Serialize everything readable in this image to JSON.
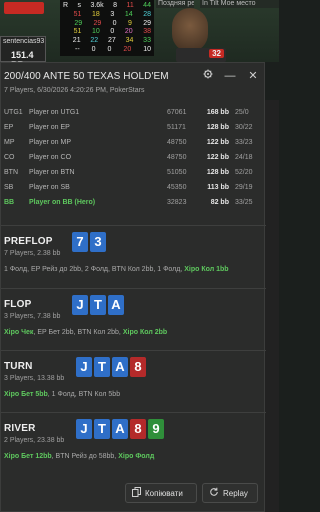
{
  "background": {
    "player_name": "sentencias93",
    "player_stack": "151.4 BB",
    "hud_rows": [
      [
        "R",
        "s",
        "3.6k",
        "8",
        "11",
        "44"
      ],
      [
        "",
        "51",
        "18",
        "3",
        "14",
        "28"
      ],
      [
        "",
        "29",
        "29",
        "0",
        "9",
        "29"
      ],
      [
        "",
        "51",
        "10",
        "0",
        "20",
        "38"
      ],
      [
        "",
        "21",
        "22",
        "27",
        "34",
        "33"
      ],
      [
        "",
        "--",
        "0",
        "0",
        "20",
        "10"
      ]
    ],
    "tab1": "Поздняя рег",
    "tab2": "In Tilt   Мое место",
    "badge_num": "32"
  },
  "dialog": {
    "title": "200/400 ANTE 50 TEXAS HOLD'EM",
    "subtitle": "7 Players, 6/30/2026 4:20:26 PM, PokerStars",
    "settings_icon": "gear-icon",
    "minimize_label": "—",
    "close_label": "✕"
  },
  "players": [
    {
      "pos": "UTG1",
      "name": "Player on UTG1",
      "chips": "67061",
      "bb": "168 bb",
      "vpip": "25/0"
    },
    {
      "pos": "EP",
      "name": "Player on EP",
      "chips": "51171",
      "bb": "128 bb",
      "vpip": "30/22"
    },
    {
      "pos": "MP",
      "name": "Player on MP",
      "chips": "48750",
      "bb": "122 bb",
      "vpip": "33/23"
    },
    {
      "pos": "CO",
      "name": "Player on CO",
      "chips": "48750",
      "bb": "122 bb",
      "vpip": "24/18"
    },
    {
      "pos": "BTN",
      "name": "Player on BTN",
      "chips": "51050",
      "bb": "128 bb",
      "vpip": "52/20"
    },
    {
      "pos": "SB",
      "name": "Player on SB",
      "chips": "45350",
      "bb": "113 bb",
      "vpip": "29/19"
    },
    {
      "pos": "BB",
      "name": "Player on BB (Hero)",
      "chips": "32823",
      "bb": "82 bb",
      "vpip": "33/25"
    }
  ],
  "streets": [
    {
      "name": "PREFLOP",
      "info": "7 Players, 2.38 bb",
      "cards": [
        {
          "rank": "7",
          "suit": "s"
        },
        {
          "rank": "3",
          "suit": "s"
        }
      ],
      "actions": [
        {
          "text": "1 Фолд, EP Рейз до 2bb, 2 Фолд, BTN Кол 2bb, 1 Фолд, ",
          "hero": false
        },
        {
          "text": "Xiро Кол 1bb",
          "hero": true
        }
      ]
    },
    {
      "name": "FLOP",
      "info": "3 Players, 7.38 bb",
      "cards": [
        {
          "rank": "J",
          "suit": "s"
        },
        {
          "rank": "T",
          "suit": "s"
        },
        {
          "rank": "A",
          "suit": "s"
        }
      ],
      "actions": [
        {
          "text": "Xiро Чек",
          "hero": true
        },
        {
          "text": ", EP Бет 2bb, BTN Кол 2bb, ",
          "hero": false
        },
        {
          "text": "Xiро Кол 2bb",
          "hero": true
        }
      ]
    },
    {
      "name": "TURN",
      "info": "3 Players, 13.38 bb",
      "cards": [
        {
          "rank": "J",
          "suit": "s"
        },
        {
          "rank": "T",
          "suit": "s"
        },
        {
          "rank": "A",
          "suit": "s"
        },
        {
          "rank": "8",
          "suit": "h"
        }
      ],
      "actions": [
        {
          "text": "Xiро Бет 5bb",
          "hero": true
        },
        {
          "text": ", 1 Фолд, BTN Кол 5bb",
          "hero": false
        }
      ]
    },
    {
      "name": "RIVER",
      "info": "2 Players, 23.38 bb",
      "cards": [
        {
          "rank": "J",
          "suit": "s"
        },
        {
          "rank": "T",
          "suit": "s"
        },
        {
          "rank": "A",
          "suit": "s"
        },
        {
          "rank": "8",
          "suit": "h"
        },
        {
          "rank": "9",
          "suit": "c"
        }
      ],
      "actions": [
        {
          "text": "Xiро Бет 12bb",
          "hero": true
        },
        {
          "text": ", BTN Рейз до 58bb, ",
          "hero": false
        },
        {
          "text": "Xiро Фолд",
          "hero": true
        }
      ]
    }
  ],
  "footer": {
    "copy_label": "Копіювати",
    "copy_icon": "copy-icon",
    "replay_label": "Replay",
    "replay_icon": "replay-icon"
  }
}
